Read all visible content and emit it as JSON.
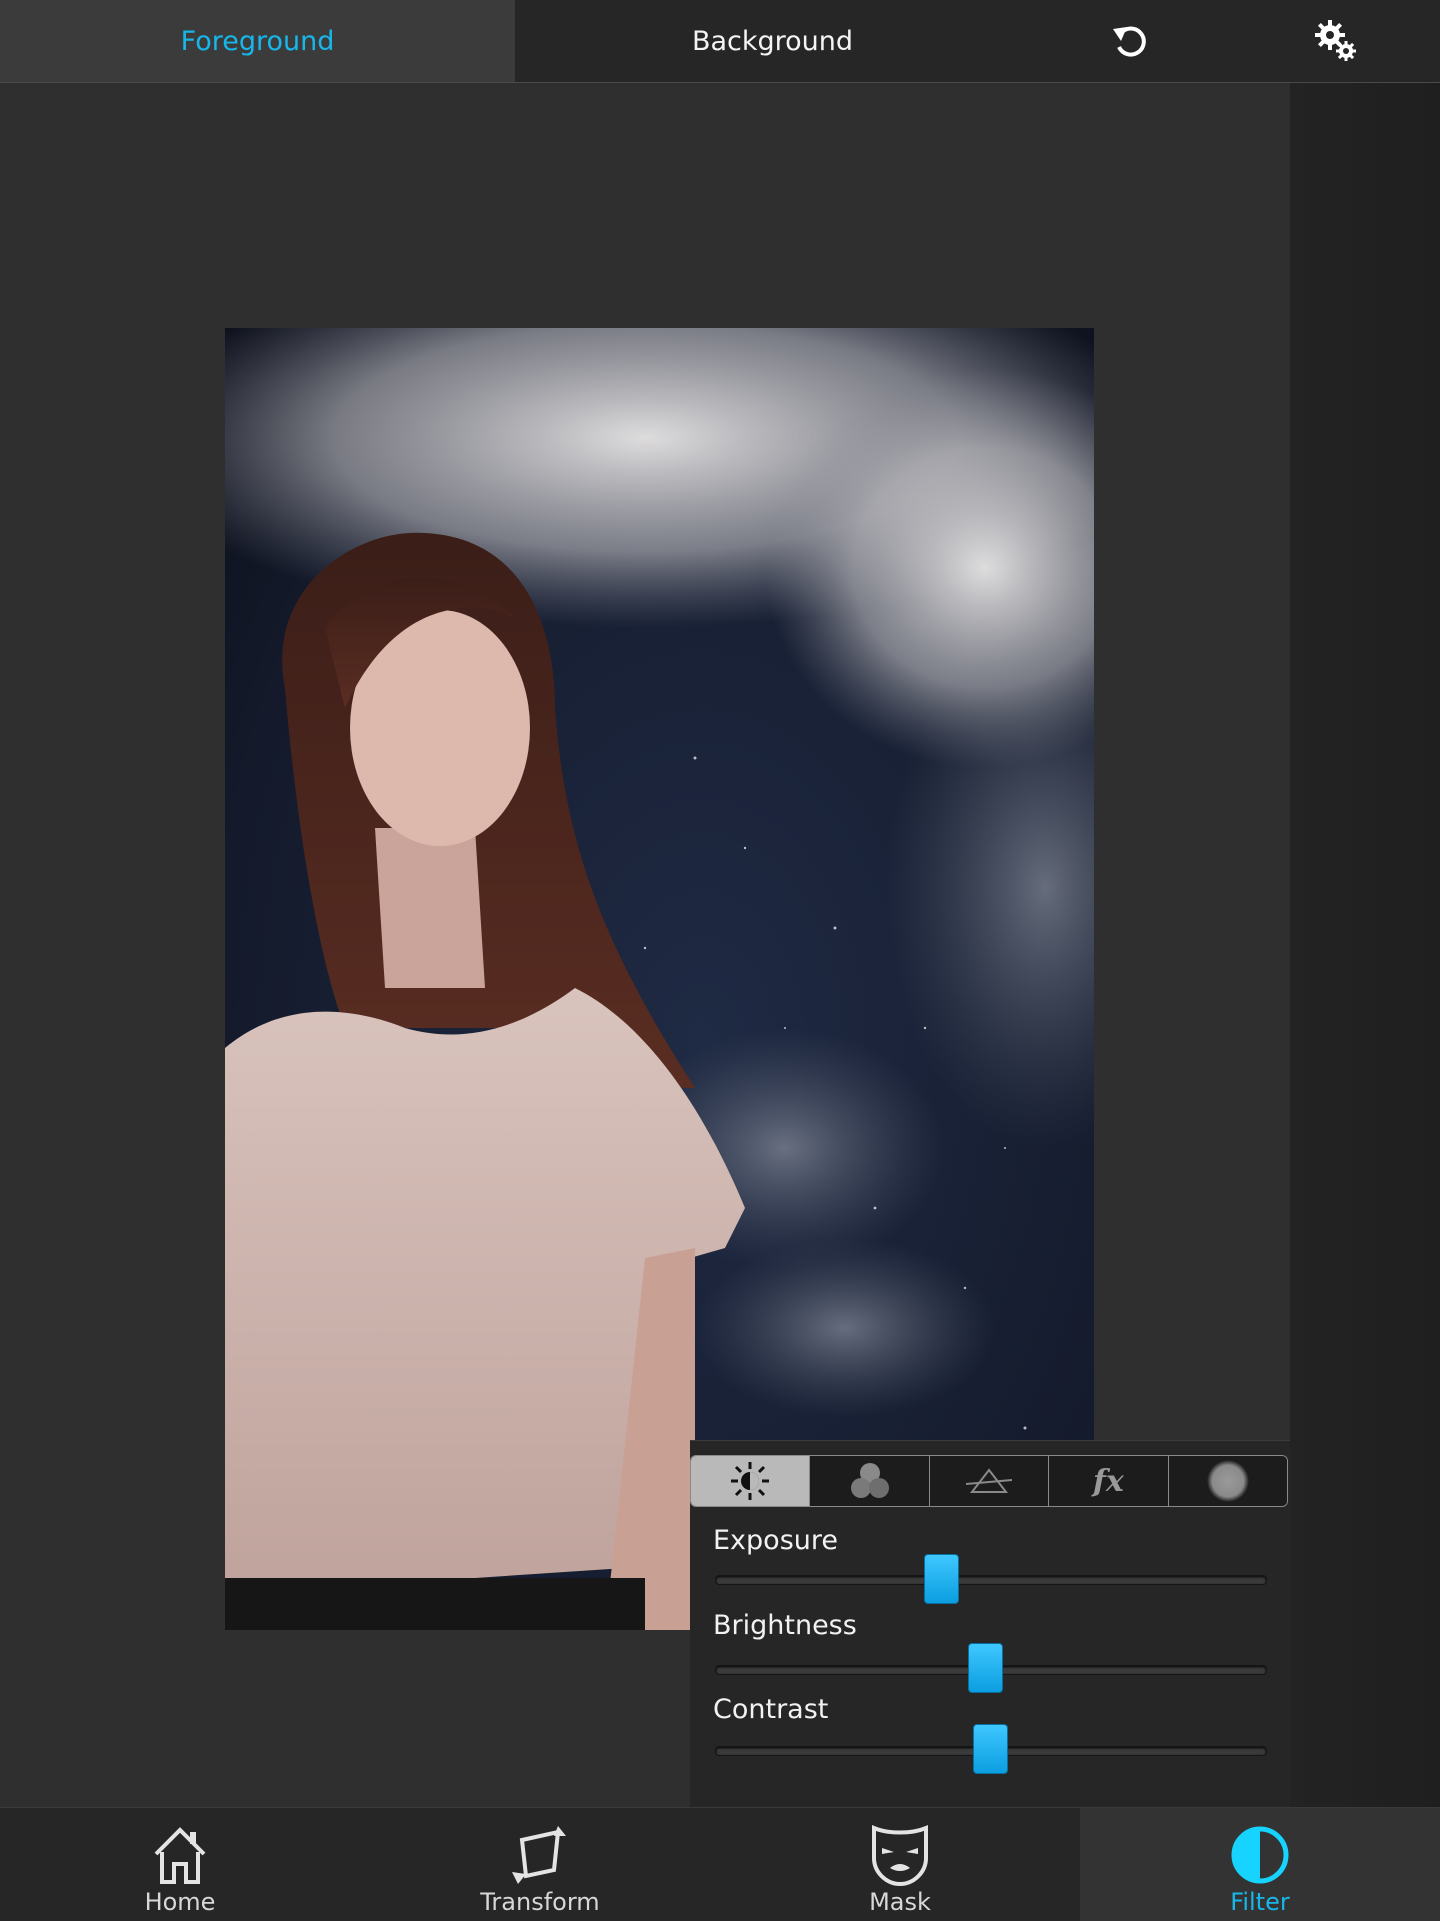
{
  "topbar": {
    "tab_foreground": "Foreground",
    "tab_background": "Background",
    "undo_icon": "undo-icon",
    "settings_icon": "gears-icon",
    "active_tab": "Foreground",
    "accent_color": "#17b7ea"
  },
  "filter_panel": {
    "tabs": [
      {
        "icon": "exposure-icon",
        "active": true
      },
      {
        "icon": "color-circles-icon",
        "active": false
      },
      {
        "icon": "prism-icon",
        "active": false
      },
      {
        "icon": "fx-icon",
        "active": false
      },
      {
        "icon": "blur-circle-icon",
        "active": false
      }
    ],
    "fx_text": "fx",
    "sliders": [
      {
        "label": "Exposure",
        "value": 0.41
      },
      {
        "label": "Brightness",
        "value": 0.49
      },
      {
        "label": "Contrast",
        "value": 0.5
      }
    ]
  },
  "bottom_nav": {
    "items": [
      {
        "label": "Home",
        "icon": "home-icon",
        "active": false
      },
      {
        "label": "Transform",
        "icon": "transform-icon",
        "active": false
      },
      {
        "label": "Mask",
        "icon": "mask-icon",
        "active": false
      },
      {
        "label": "Filter",
        "icon": "filter-icon",
        "active": true
      }
    ]
  }
}
